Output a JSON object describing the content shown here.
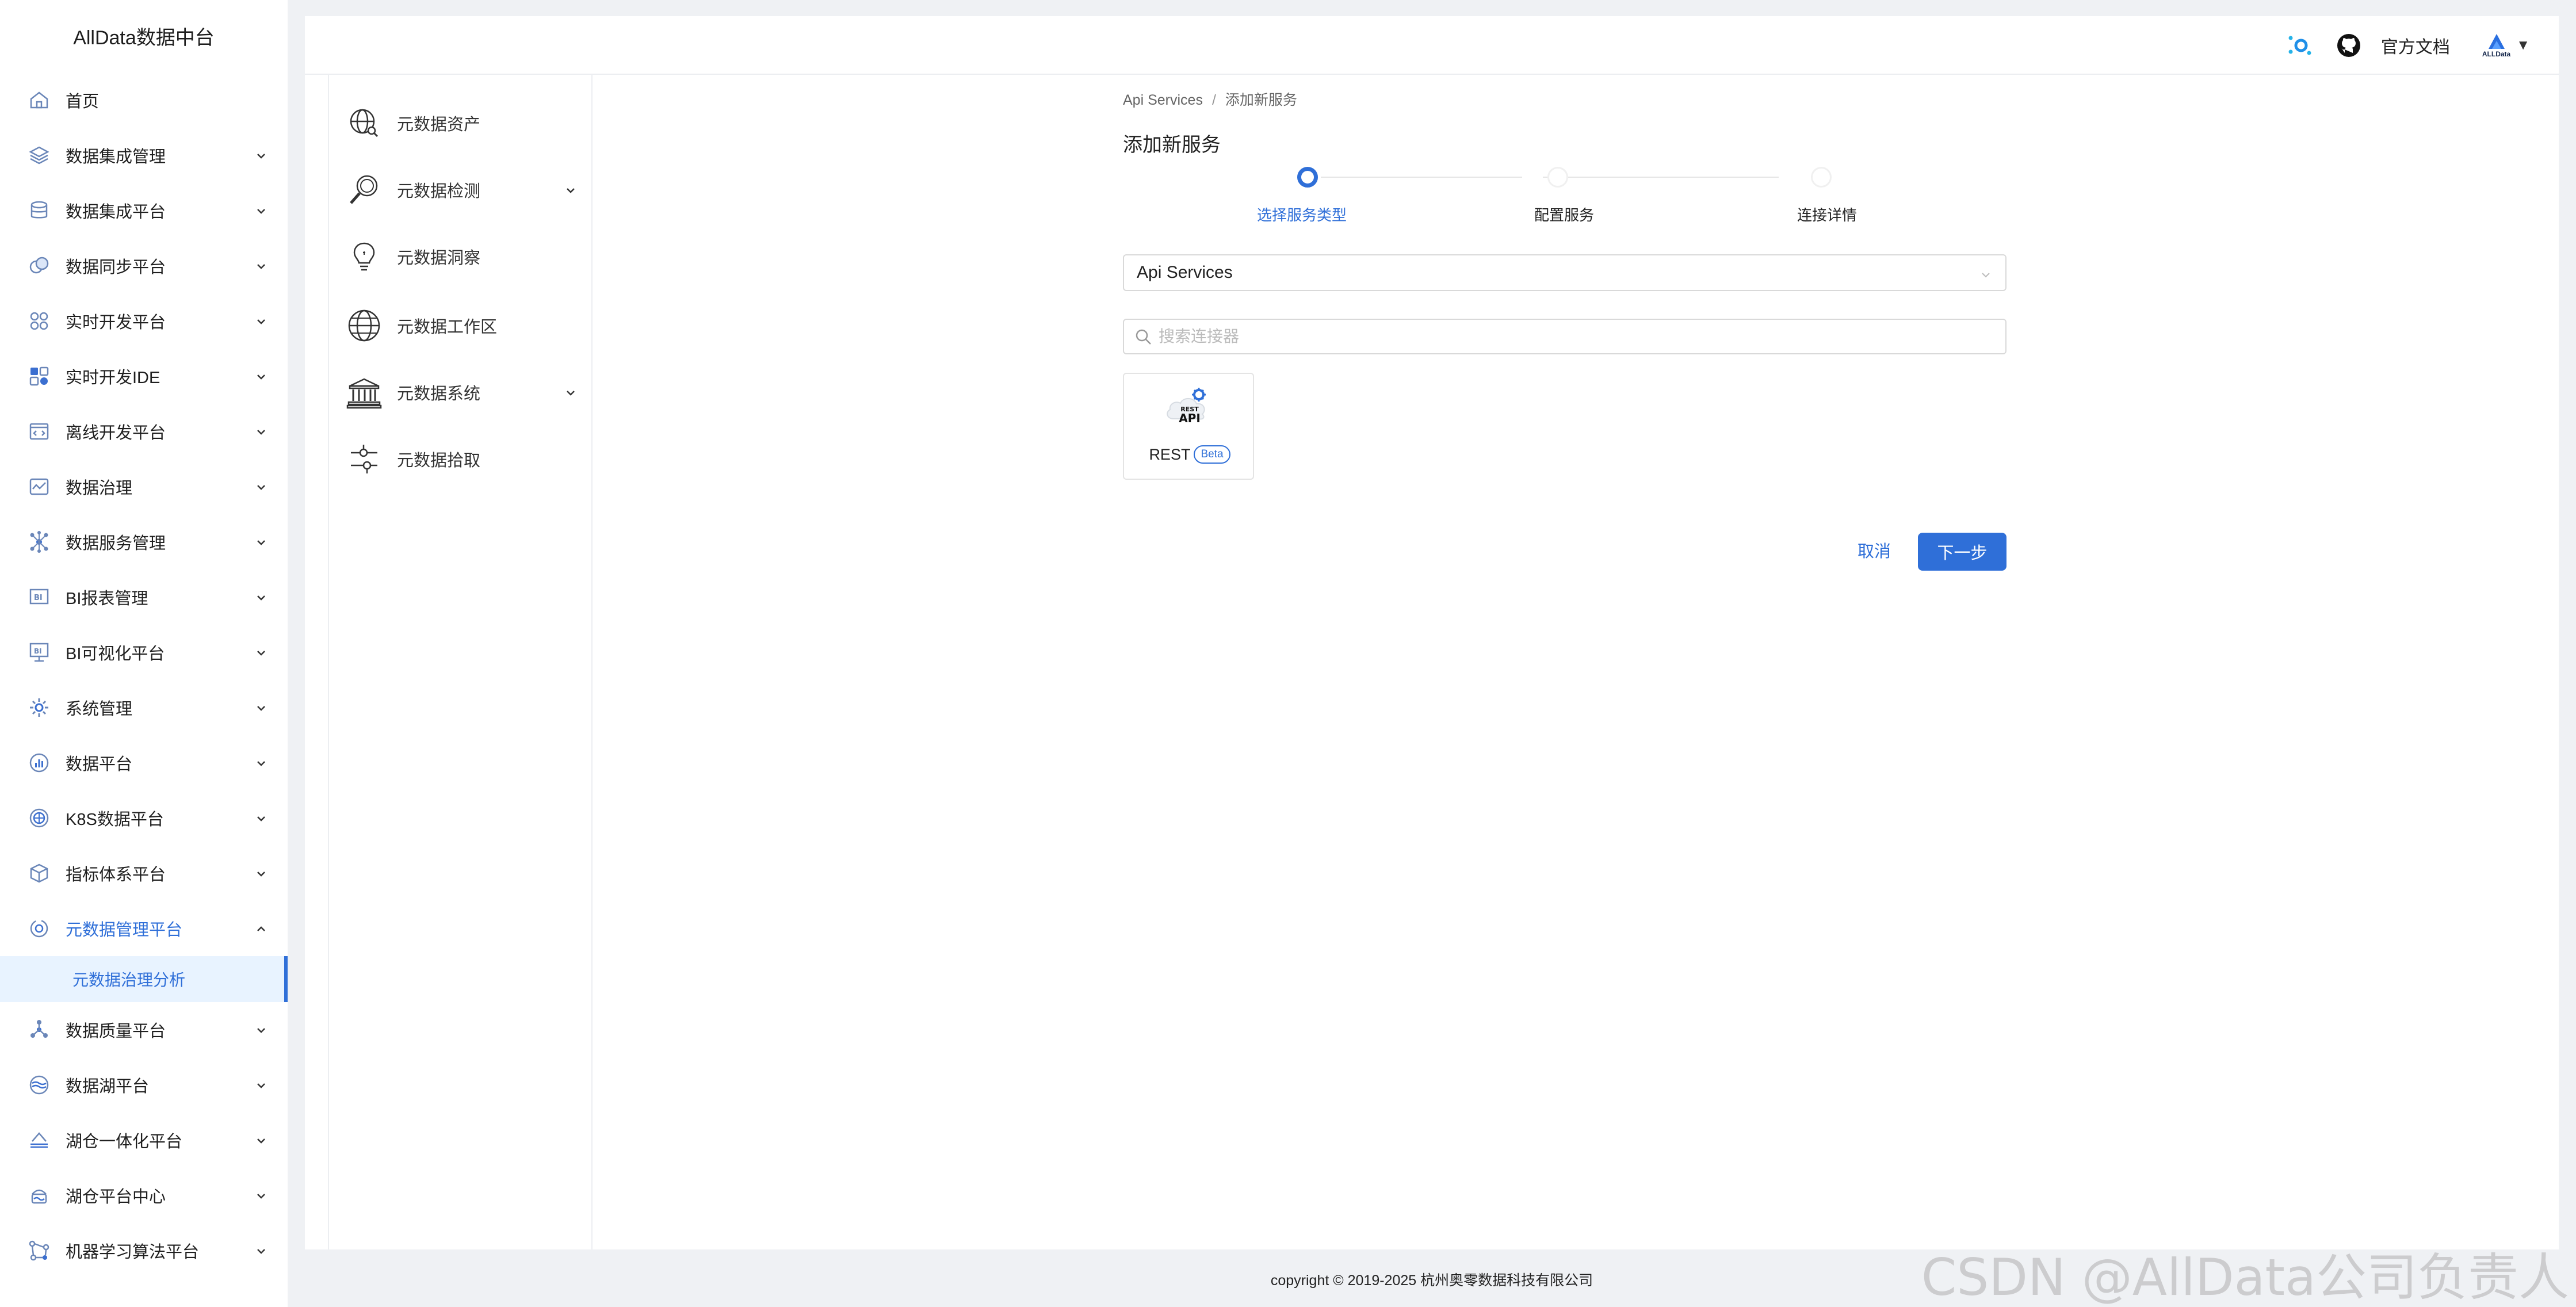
{
  "app": {
    "brand": "AllData数据中台"
  },
  "sidebar": {
    "items": [
      {
        "label": "首页",
        "icon": "home-icon"
      },
      {
        "label": "数据集成管理",
        "icon": "layers-icon"
      },
      {
        "label": "数据集成平台",
        "icon": "database-icon"
      },
      {
        "label": "数据同步平台",
        "icon": "sync-icon"
      },
      {
        "label": "实时开发平台",
        "icon": "grid-icon"
      },
      {
        "label": "实时开发IDE",
        "icon": "blocks-icon"
      },
      {
        "label": "离线开发平台",
        "icon": "code-window-icon"
      },
      {
        "label": "数据治理",
        "icon": "heartbeat-icon"
      },
      {
        "label": "数据服务管理",
        "icon": "network-icon"
      },
      {
        "label": "BI报表管理",
        "icon": "bi-report-icon"
      },
      {
        "label": "BI可视化平台",
        "icon": "bi-monitor-icon"
      },
      {
        "label": "系统管理",
        "icon": "gear-icon"
      },
      {
        "label": "数据平台",
        "icon": "bar-chart-icon"
      },
      {
        "label": "K8S数据平台",
        "icon": "k8s-icon"
      },
      {
        "label": "指标体系平台",
        "icon": "cube-icon"
      },
      {
        "label": "元数据管理平台",
        "icon": "metadata-icon"
      }
    ],
    "sub_item": "元数据治理分析",
    "items_after": [
      {
        "label": "数据质量平台",
        "icon": "molecule-icon"
      },
      {
        "label": "数据湖平台",
        "icon": "lake-icon"
      },
      {
        "label": "湖仓一体化平台",
        "icon": "lakehouse-icon"
      },
      {
        "label": "湖仓平台中心",
        "icon": "lakehouse-center-icon"
      },
      {
        "label": "机器学习算法平台",
        "icon": "ml-icon"
      }
    ]
  },
  "header": {
    "docs": "官方文档",
    "logo_text": "ALLData",
    "caret": "▼"
  },
  "inner_nav": {
    "items": [
      {
        "label": "元数据资产",
        "icon": "globe-search-icon"
      },
      {
        "label": "元数据检测",
        "icon": "magnifier-icon"
      },
      {
        "label": "元数据洞察",
        "icon": "lightbulb-icon"
      },
      {
        "label": "元数据工作区",
        "icon": "globe-icon"
      },
      {
        "label": "元数据系统",
        "icon": "bank-icon"
      },
      {
        "label": "元数据拾取",
        "icon": "sliders-icon"
      }
    ]
  },
  "main": {
    "breadcrumb": {
      "root": "Api Services",
      "sep": "/",
      "current": "添加新服务"
    },
    "title": "添加新服务",
    "steps": [
      {
        "label": "选择服务类型",
        "active": true
      },
      {
        "label": "配置服务",
        "active": false
      },
      {
        "label": "连接详情",
        "active": false
      }
    ],
    "service_type": "Api Services",
    "search": {
      "placeholder": "搜索连接器",
      "value": ""
    },
    "connector": {
      "name": "REST",
      "badge": "Beta",
      "logo_top": "REST",
      "logo_bottom": "API"
    },
    "cancel_label": "取消",
    "next_label": "下一步"
  },
  "footer": {
    "copyright": "copyright © 2019-2025 杭州奥零数据科技有限公司"
  },
  "watermark": "CSDN @AllData公司负责人",
  "colors": {
    "accent": "#2f6fd8",
    "sidebar_active_bg": "#e8f3ff",
    "page_bg": "#eff1f4"
  }
}
